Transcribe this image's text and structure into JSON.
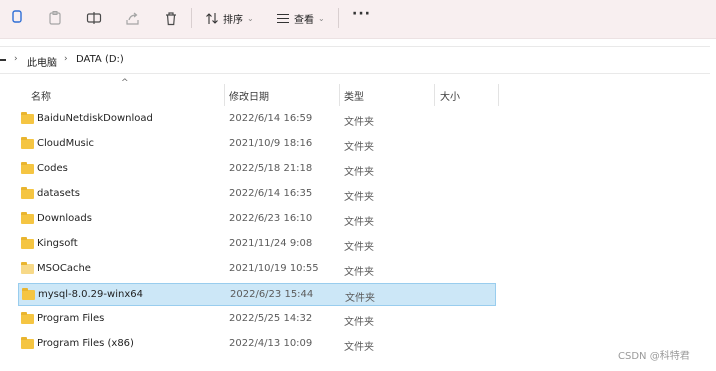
{
  "toolbar": {
    "icons": [
      "copy-icon",
      "paste-icon",
      "rename-icon",
      "share-icon",
      "delete-icon"
    ],
    "sort_label": "排序",
    "view_label": "查看",
    "more_label": "···"
  },
  "address": {
    "crumbs": [
      "此电脑",
      "DATA (D:)"
    ]
  },
  "columns": {
    "name": "名称",
    "modified": "修改日期",
    "type": "类型",
    "size": "大小"
  },
  "files": [
    {
      "name": "BaiduNetdiskDownload",
      "date": "2022/6/14 16:59",
      "type": "文件夹"
    },
    {
      "name": "CloudMusic",
      "date": "2021/10/9 18:16",
      "type": "文件夹"
    },
    {
      "name": "Codes",
      "date": "2022/5/18 21:18",
      "type": "文件夹"
    },
    {
      "name": "datasets",
      "date": "2022/6/14 16:35",
      "type": "文件夹"
    },
    {
      "name": "Downloads",
      "date": "2022/6/23 16:10",
      "type": "文件夹"
    },
    {
      "name": "Kingsoft",
      "date": "2021/11/24 9:08",
      "type": "文件夹"
    },
    {
      "name": "MSOCache",
      "date": "2021/10/19 10:55",
      "type": "文件夹"
    },
    {
      "name": "mysql-8.0.29-winx64",
      "date": "2022/6/23 15:44",
      "type": "文件夹",
      "selected": true
    },
    {
      "name": "Program Files",
      "date": "2022/5/25 14:32",
      "type": "文件夹"
    },
    {
      "name": "Program Files (x86)",
      "date": "2022/4/13 10:09",
      "type": "文件夹"
    }
  ],
  "watermark": "CSDN @科特君",
  "colors": {
    "folder": "#f5c542",
    "selection": "#cce7f7",
    "toolbar_bg": "#f8eff0"
  }
}
